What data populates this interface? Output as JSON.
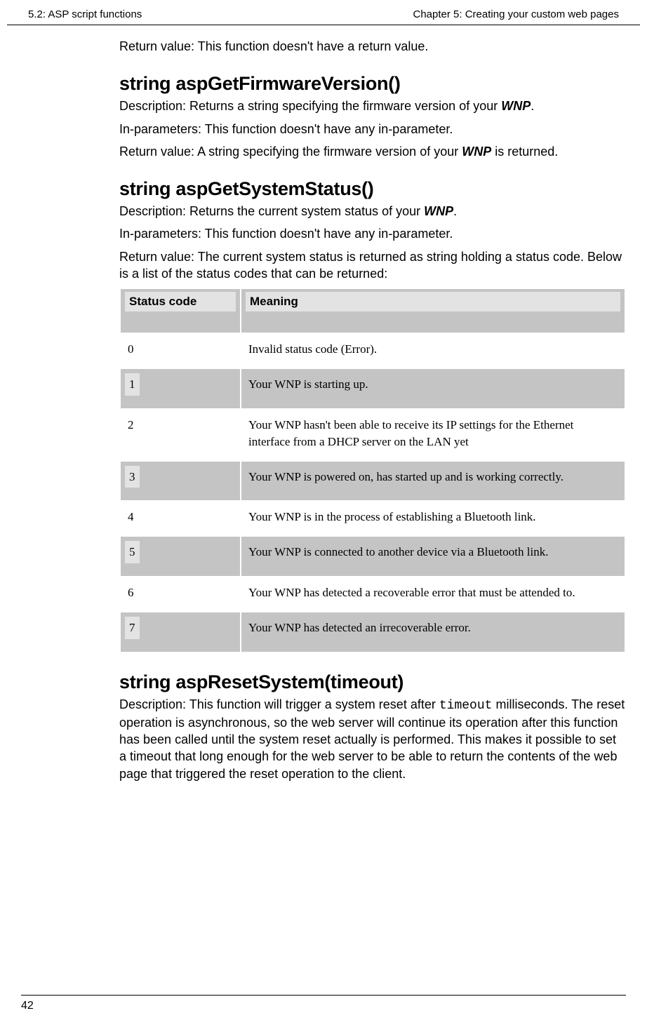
{
  "header": {
    "left": "5.2: ASP script functions",
    "right": "Chapter 5: Creating your custom web pages"
  },
  "intro_return": "Return value: This function doesn't have a return value.",
  "fn1": {
    "title": "string aspGetFirmwareVersion()",
    "desc_pre": "Description: Returns a string specifying the firmware version of your ",
    "desc_wnp": "WNP",
    "desc_post": ".",
    "inparam": "In-parameters: This function doesn't have any in-parameter.",
    "ret_pre": "Return value: A string specifying the firmware version of your ",
    "ret_wnp": "WNP",
    "ret_post": " is returned."
  },
  "fn2": {
    "title": "string aspGetSystemStatus()",
    "desc_pre": "Description: Returns the current system status of your ",
    "desc_wnp": "WNP",
    "desc_post": ".",
    "inparam": "In-parameters: This function doesn't have any in-parameter.",
    "ret": "Return value: The current system status is returned as string holding a status code. Below is a list of the status codes that can be returned:"
  },
  "table": {
    "h1": "Status code",
    "h2": "Meaning",
    "rows": [
      {
        "c": "0",
        "m": "Invalid status code (Error)."
      },
      {
        "c": "1",
        "m": "Your WNP is starting up."
      },
      {
        "c": "2",
        "m": "Your WNP hasn't been able to receive its IP settings for the Ethernet interface from a DHCP server on the LAN yet"
      },
      {
        "c": "3",
        "m": "Your WNP is powered on, has started up and is working correctly."
      },
      {
        "c": "4",
        "m": "Your WNP is in the process of establishing a Bluetooth link."
      },
      {
        "c": "5",
        "m": "Your WNP is connected to another device via a Bluetooth link."
      },
      {
        "c": "6",
        "m": "Your WNP has detected a recoverable error that must be attended to."
      },
      {
        "c": "7",
        "m": "Your WNP has detected an irrecoverable error."
      }
    ]
  },
  "fn3": {
    "title": "string aspResetSystem(timeout)",
    "desc_pre": "Description: This function will trigger a system reset after ",
    "desc_code": "timeout",
    "desc_post": " milliseconds. The reset operation is asynchronous, so the web server will continue its operation after this function has been called until the system reset actually is performed. This makes it possible to set a timeout that long enough for the web server to be able to return the contents of the web page that triggered the reset operation to the client."
  },
  "page_number": "42"
}
